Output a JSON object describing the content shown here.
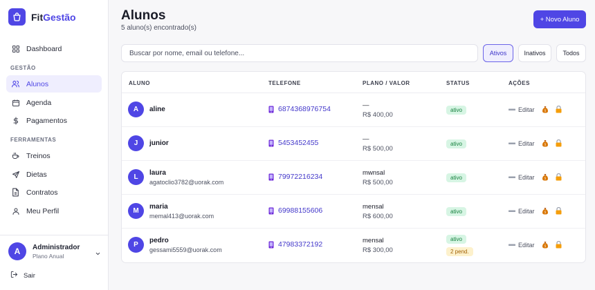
{
  "brand": {
    "name_part1": "Fit",
    "name_part2": "Gestão"
  },
  "sidebar": {
    "dashboard": "Dashboard",
    "section_gestao": "GESTÃO",
    "gestao_items": [
      "Alunos",
      "Agenda",
      "Pagamentos"
    ],
    "section_ferramentas": "FERRAMENTAS",
    "ferramentas_items": [
      "Treinos",
      "Dietas",
      "Contratos",
      "Meu Perfil"
    ],
    "user": {
      "initial": "A",
      "name": "Administrador",
      "plan": "Plano Anual"
    },
    "logout": "Sair"
  },
  "header": {
    "title": "Alunos",
    "subtitle": "5 aluno(s) encontrado(s)",
    "new_button": "+ Novo Aluno"
  },
  "search": {
    "placeholder": "Buscar por nome, email ou telefone..."
  },
  "filters": [
    "Ativos",
    "Inativos",
    "Todos"
  ],
  "active_filter": "Ativos",
  "table": {
    "columns": [
      "ALUNO",
      "TELEFONE",
      "PLANO / VALOR",
      "STATUS",
      "AÇÕES"
    ],
    "edit_label": "Editar",
    "rows": [
      {
        "initial": "A",
        "name": "aline",
        "email": "",
        "phone": "6874368976754",
        "plan": "—",
        "value": "R$ 400,00",
        "status": "ativo",
        "pending": ""
      },
      {
        "initial": "J",
        "name": "junior",
        "email": "",
        "phone": "5453452455",
        "plan": "—",
        "value": "R$ 500,00",
        "status": "ativo",
        "pending": ""
      },
      {
        "initial": "L",
        "name": "laura",
        "email": "agatoclio3782@uorak.com",
        "phone": "79972216234",
        "plan": "mwnsal",
        "value": "R$ 500,00",
        "status": "ativo",
        "pending": ""
      },
      {
        "initial": "M",
        "name": "maria",
        "email": "memal413@uorak.com",
        "phone": "69988155606",
        "plan": "mensal",
        "value": "R$ 600,00",
        "status": "ativo",
        "pending": ""
      },
      {
        "initial": "P",
        "name": "pedro",
        "email": "gessami5559@uorak.com",
        "phone": "47983372192",
        "plan": "mensal",
        "value": "R$ 300,00",
        "status": "ativo",
        "pending": "2 pend."
      }
    ]
  },
  "colors": {
    "accent": "#4f46e5",
    "success_bg": "#d7f5e4",
    "success_text": "#15803d",
    "warning_bg": "#fdf1cc",
    "warning_text": "#a16207"
  }
}
